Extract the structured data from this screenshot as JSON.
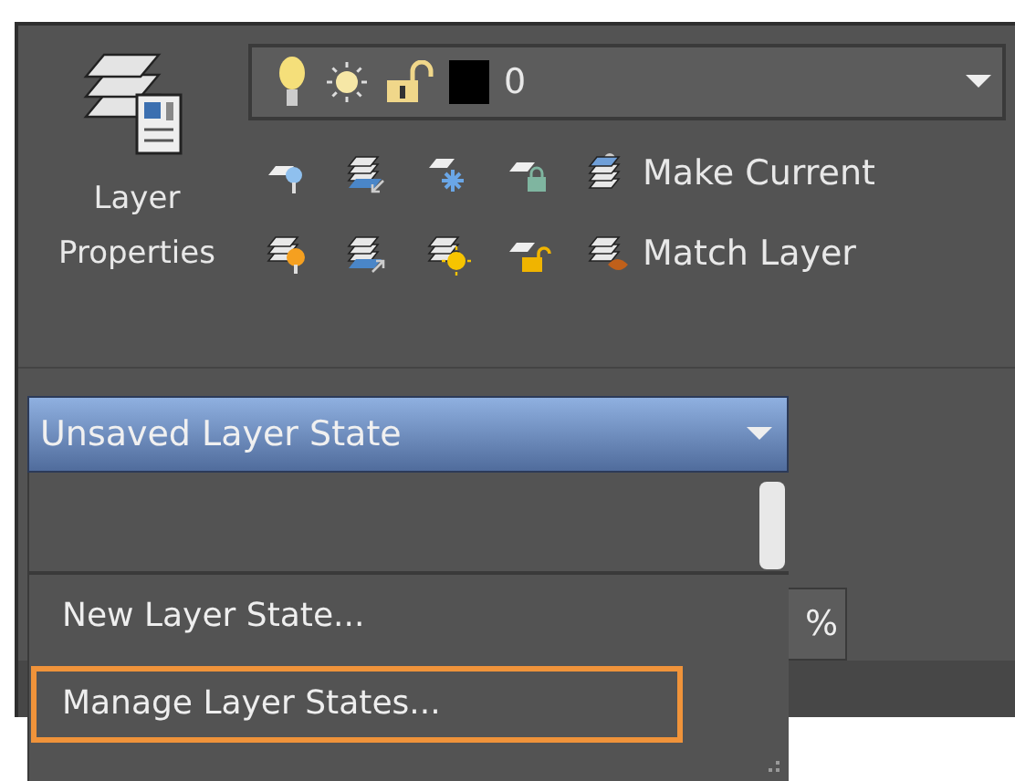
{
  "layer_properties": {
    "label": "Layer Properties"
  },
  "layer_combo": {
    "value": "0"
  },
  "tool_rows": [
    {
      "label": "Make Current"
    },
    {
      "label": "Match Layer"
    }
  ],
  "percent_field": {
    "value": "%"
  },
  "layer_state": {
    "value": "Unsaved Layer State",
    "expanded": true,
    "items": [
      {
        "label": "New Layer State...",
        "selected": false
      },
      {
        "label": "Manage Layer States...",
        "selected": true
      }
    ]
  }
}
